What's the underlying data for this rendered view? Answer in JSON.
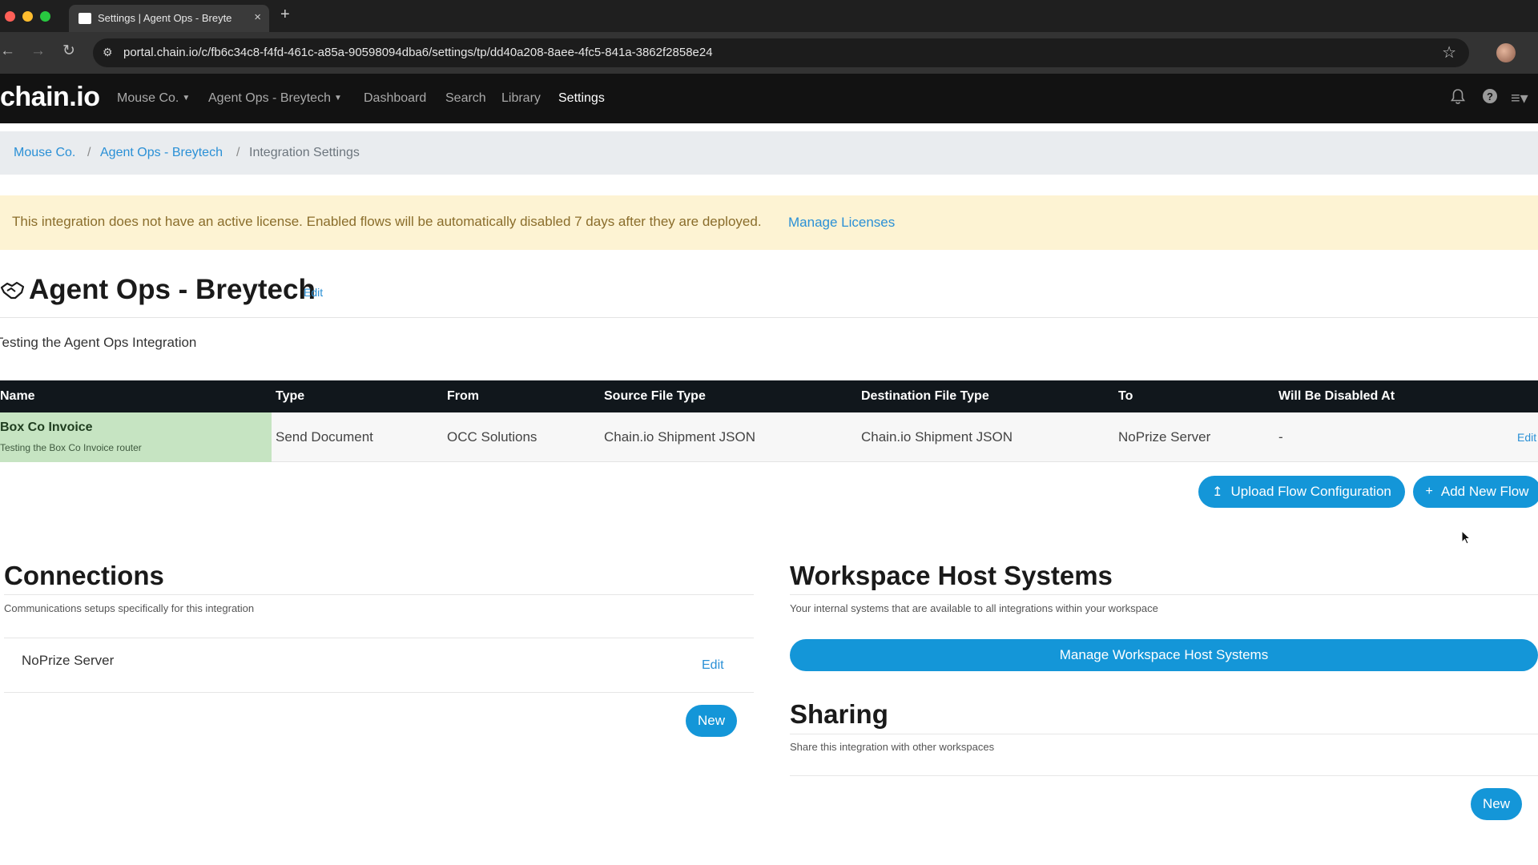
{
  "browser": {
    "tab_title": "Settings | Agent Ops - Breyte",
    "tab_close": "×",
    "new_tab": "+",
    "url": "portal.chain.io/c/fb6c34c8-f4fd-461c-a85a-90598094dba6/settings/tp/dd40a208-8aee-4fc5-841a-3862f2858e24"
  },
  "navbar": {
    "brand": "chain.io",
    "items": [
      {
        "label": "Mouse Co.",
        "dropdown": true
      },
      {
        "label": "Agent Ops - Breytech",
        "dropdown": true
      },
      {
        "label": "Dashboard"
      },
      {
        "label": "Search"
      },
      {
        "label": "Library"
      },
      {
        "label": "Settings",
        "active": true
      }
    ]
  },
  "breadcrumb": {
    "items": [
      "Mouse Co.",
      "Agent Ops - Breytech",
      "Integration Settings"
    ],
    "separator": "/"
  },
  "alert": {
    "text": "This integration does not have an active license. Enabled flows will be automatically disabled 7 days after they are deployed.",
    "link": "Manage Licenses"
  },
  "integration": {
    "title": "Agent Ops - Breytech",
    "edit_label": "Edit",
    "description": "Testing the Agent Ops Integration"
  },
  "flows_table": {
    "headers": [
      "Name",
      "Type",
      "From",
      "Source File Type",
      "Destination File Type",
      "To",
      "Will Be Disabled At"
    ],
    "rows": [
      {
        "name": "Box Co Invoice",
        "description": "Testing the Box Co Invoice router",
        "type": "Send Document",
        "from": "OCC Solutions",
        "source_file_type": "Chain.io Shipment JSON",
        "destination_file_type": "Chain.io Shipment JSON",
        "to": "NoPrize Server",
        "disabled_at": "-",
        "edit_label": "Edit"
      }
    ]
  },
  "actions": {
    "upload_flow": "Upload Flow Configuration",
    "add_flow": "Add New Flow"
  },
  "connections": {
    "title": "Connections",
    "subtitle": "Communications setups specifically for this integration",
    "items": [
      {
        "name": "NoPrize Server",
        "edit_label": "Edit"
      }
    ],
    "new_label": "New"
  },
  "workspace_hosts": {
    "title": "Workspace Host Systems",
    "subtitle": "Your internal systems that are available to all integrations within your workspace",
    "button": "Manage Workspace Host Systems"
  },
  "sharing": {
    "title": "Sharing",
    "subtitle": "Share this integration with other workspaces",
    "new_label": "New"
  },
  "colors": {
    "accent": "#1496d8",
    "link": "#2a90d6",
    "alert_bg": "#fdf3d3",
    "row_highlight": "#c6e4c2",
    "table_header": "#11171c"
  },
  "icons": {
    "integration": "handshake-icon",
    "upload": "upload-icon",
    "add": "plus-icon",
    "bell": "bell-icon",
    "help": "help-icon",
    "menu": "hamburger-menu-icon"
  }
}
